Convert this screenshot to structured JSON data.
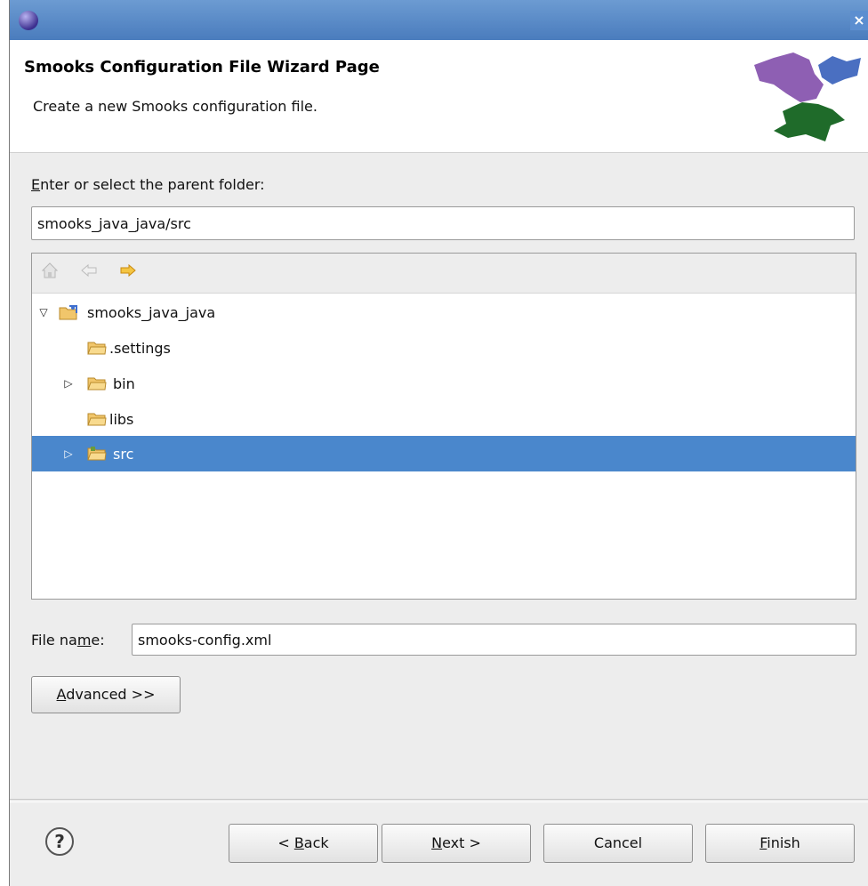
{
  "window": {
    "close_glyph": "×"
  },
  "header": {
    "title": "Smooks Configuration File Wizard Page",
    "description": "Create a new Smooks configuration file."
  },
  "folder": {
    "label_mnemonic": "E",
    "label_rest": "nter or select the parent folder:",
    "value": "smooks_java_java/src"
  },
  "tree": {
    "toolbar": [
      "home-icon",
      "back-arrow-icon",
      "forward-arrow-icon"
    ],
    "items": [
      {
        "label": "smooks_java_java",
        "icon": "java-project-icon",
        "twisty": "▽",
        "expanded": true
      },
      {
        "label": ".settings",
        "icon": "folder-icon",
        "twisty": ""
      },
      {
        "label": "bin",
        "icon": "folder-icon",
        "twisty": "▷"
      },
      {
        "label": "libs",
        "icon": "folder-icon",
        "twisty": ""
      },
      {
        "label": "src",
        "icon": "source-folder-icon",
        "twisty": "▷",
        "selected": true
      }
    ]
  },
  "filename": {
    "label_before": "File na",
    "label_mnemonic": "m",
    "label_after": "e:",
    "value": "smooks-config.xml"
  },
  "advanced": {
    "mnemonic": "A",
    "rest": "dvanced >>"
  },
  "buttons": {
    "back_prefix": "< ",
    "back_mnemonic": "B",
    "back_rest": "ack",
    "next_mnemonic": "N",
    "next_rest": "ext >",
    "cancel": "Cancel",
    "finish_mnemonic": "F",
    "finish_rest": "inish"
  },
  "help": {
    "glyph": "?"
  },
  "colors": {
    "selection": "#4a87cc",
    "titlebar": "#5b8ed0"
  }
}
